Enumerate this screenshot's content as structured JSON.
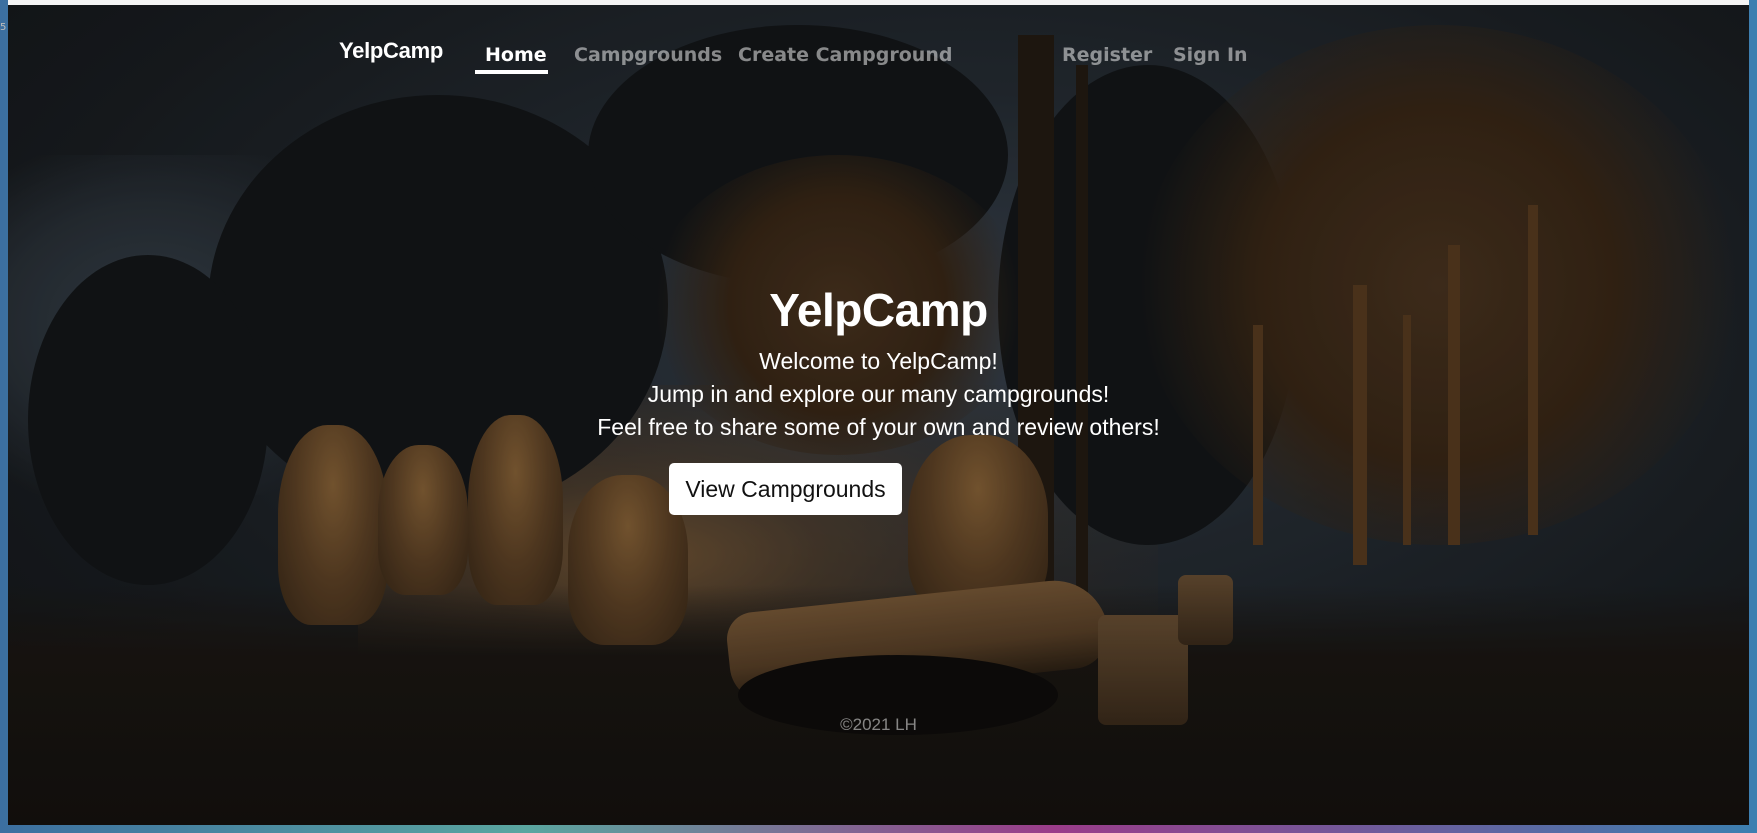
{
  "nav": {
    "brand": "YelpCamp",
    "links": [
      {
        "label": "Home",
        "active": true
      },
      {
        "label": "Campgrounds",
        "active": false
      },
      {
        "label": "Create Campground",
        "active": false
      }
    ],
    "auth_links": [
      {
        "label": "Register"
      },
      {
        "label": "Sign In"
      }
    ]
  },
  "hero": {
    "title": "YelpCamp",
    "lines": [
      "Welcome to YelpCamp!",
      "Jump in and explore our many campgrounds!",
      "Feel free to share some of your own and review others!"
    ],
    "cta_label": "View Campgrounds"
  },
  "footer": {
    "text": "©2021 LH"
  },
  "colors": {
    "text": "#ffffff",
    "muted_text": "rgba(255,255,255,0.5)",
    "button_bg": "#ffffff",
    "button_text": "#111111",
    "overlay": "rgba(0,0,0,0.5)"
  }
}
